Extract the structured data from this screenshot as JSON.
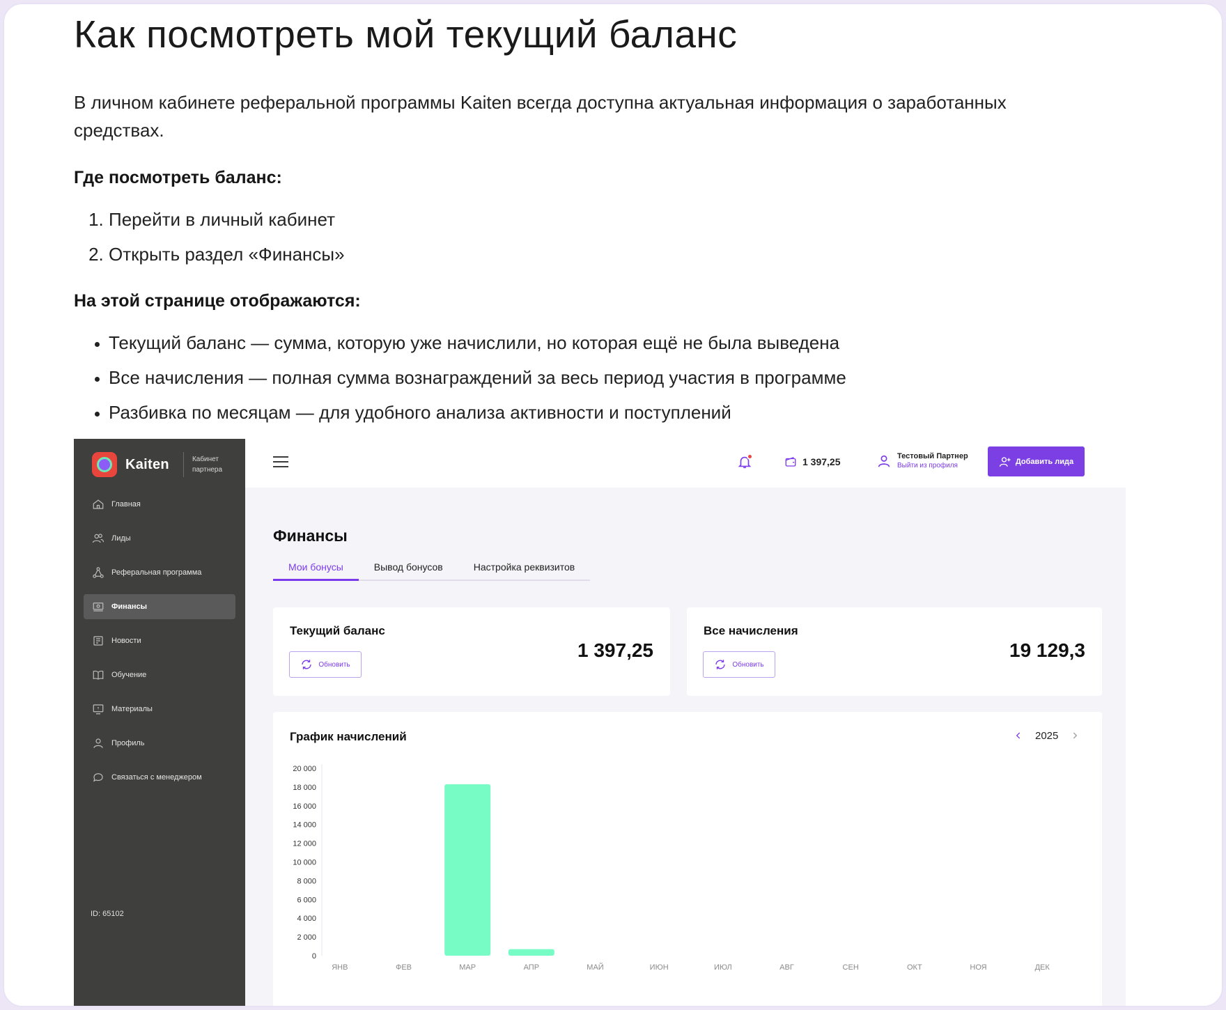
{
  "article": {
    "title": "Как посмотреть мой текущий баланс",
    "intro": "В личном кабинете реферальной программы Kaiten всегда доступна актуальная информация о заработанных средствах.",
    "where_heading": "Где посмотреть баланс:",
    "steps": [
      "Перейти в личный кабинет",
      "Открыть раздел «Финансы»"
    ],
    "shows_heading": "На этой странице отображаются:",
    "bullets": [
      "Текущий баланс — сумма, которую уже начислили, но которая ещё не была выведена",
      "Все начисления — полная сумма вознаграждений за весь период участия в программе",
      "Разбивка по месяцам — для удобного анализа активности и поступлений"
    ]
  },
  "app": {
    "logo_text": "Kaiten",
    "logo_sub": "Кабинет партнера",
    "sidebar": {
      "items": [
        {
          "label": "Главная",
          "icon": "home-icon"
        },
        {
          "label": "Лиды",
          "icon": "users-icon"
        },
        {
          "label": "Реферальная программа",
          "icon": "network-icon"
        },
        {
          "label": "Финансы",
          "icon": "finance-icon",
          "active": true
        },
        {
          "label": "Новости",
          "icon": "news-icon"
        },
        {
          "label": "Обучение",
          "icon": "book-icon"
        },
        {
          "label": "Материалы",
          "icon": "materials-icon"
        },
        {
          "label": "Профиль",
          "icon": "profile-icon"
        },
        {
          "label": "Связаться с менеджером",
          "icon": "chat-icon"
        }
      ],
      "id_text": "ID: 65102"
    },
    "topbar": {
      "balance": "1 397,25",
      "user_name": "Тестовый Партнер",
      "user_exit": "Выйти из профиля",
      "add_lead": "Добавить лида"
    },
    "page_title": "Финансы",
    "tabs": [
      "Мои бонусы",
      "Вывод бонусов",
      "Настройка реквизитов"
    ],
    "cards": {
      "current": {
        "title": "Текущий баланс",
        "value": "1 397,25",
        "refresh": "Обновить"
      },
      "total": {
        "title": "Все начисления",
        "value": "19 129,3",
        "refresh": "Обновить"
      }
    },
    "chart_title": "График начислений",
    "year": "2025",
    "accent_color": "#7c3aed",
    "bar_color": "#78fcc6"
  },
  "chart_data": {
    "type": "bar",
    "title": "График начислений",
    "categories": [
      "ЯНВ",
      "ФЕВ",
      "МАР",
      "АПР",
      "МАЙ",
      "ИЮН",
      "ИЮЛ",
      "АВГ",
      "СЕН",
      "ОКТ",
      "НОЯ",
      "ДЕК"
    ],
    "values": [
      0,
      0,
      18300,
      700,
      0,
      0,
      0,
      0,
      0,
      0,
      0,
      0
    ],
    "ylim": [
      0,
      20000
    ],
    "yticks": [
      0,
      2000,
      4000,
      6000,
      8000,
      10000,
      12000,
      14000,
      16000,
      18000,
      20000
    ],
    "ytick_labels": [
      "0",
      "2 000",
      "4 000",
      "6 000",
      "8 000",
      "10 000",
      "12 000",
      "14 000",
      "16 000",
      "18 000",
      "20 000"
    ],
    "grid": false,
    "legend": "none"
  }
}
